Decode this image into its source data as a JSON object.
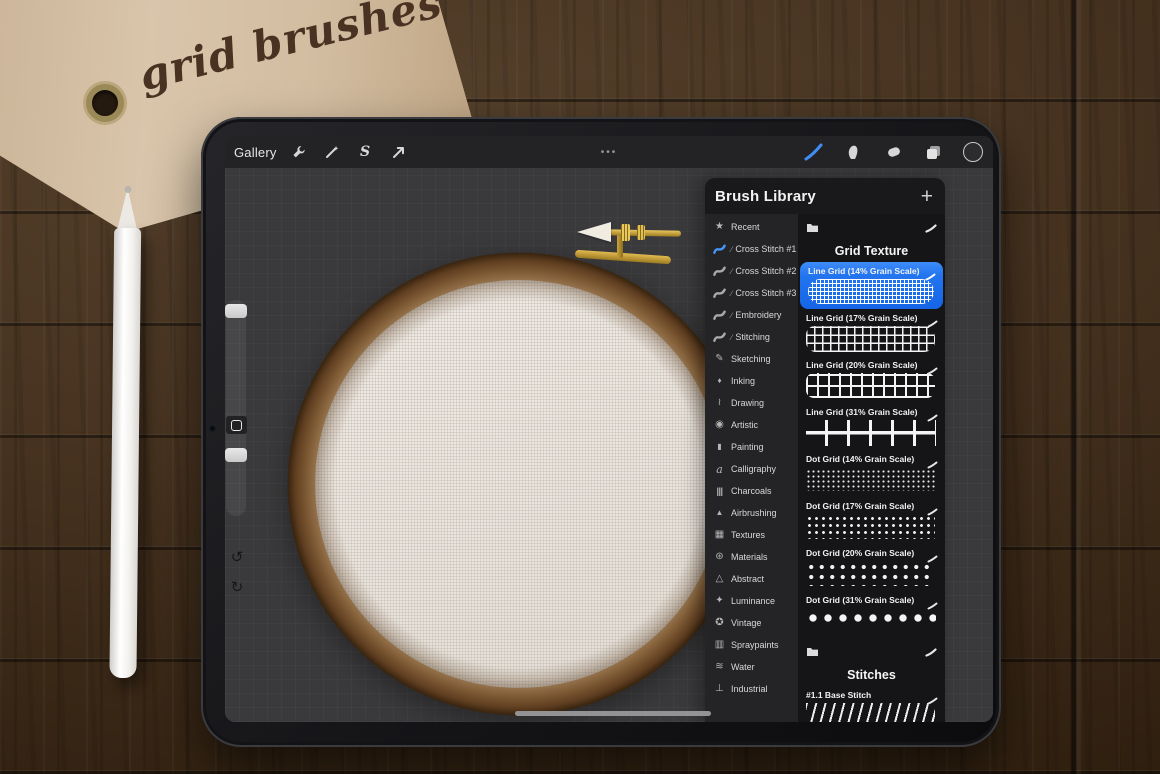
{
  "scene": {
    "tag_text": "grid brushes"
  },
  "topbar": {
    "gallery_label": "Gallery",
    "ellipsis": "•••",
    "selection_glyph": "S",
    "left_icons": [
      "wrench-icon",
      "adjustments-wand-icon",
      "selection-icon",
      "transform-arrow-icon"
    ],
    "right_icons": [
      "paint-brush-icon",
      "smudge-finger-icon",
      "eraser-icon",
      "layers-icon",
      "color-circle"
    ],
    "active_tool": "paint-brush",
    "accent_color": "#3f8ef7"
  },
  "side_tools": {
    "undo_glyph": "↺",
    "redo_glyph": "↻"
  },
  "library": {
    "title": "Brush Library",
    "add_label": "+",
    "set_prefix_glyph": "∕",
    "selected_brush": "Line Grid (14% Grain Scale)",
    "selected_color": "#2274ef",
    "categories": [
      {
        "label": "Recent",
        "icon": "star-icon",
        "glyph": "★"
      },
      {
        "label": "Cross Stitch #1",
        "icon": "brush-stroke-icon"
      },
      {
        "label": "Cross Stitch #2",
        "icon": "brush-stroke-icon"
      },
      {
        "label": "Cross Stitch #3",
        "icon": "brush-stroke-icon"
      },
      {
        "label": "Embroidery",
        "icon": "brush-stroke-icon"
      },
      {
        "label": "Stitching",
        "icon": "brush-stroke-icon"
      },
      {
        "label": "Sketching",
        "icon": "pencil-icon",
        "glyph": "✎"
      },
      {
        "label": "Inking",
        "icon": "ink-drop-icon",
        "glyph": "♦"
      },
      {
        "label": "Drawing",
        "icon": "squiggle-icon",
        "glyph": "≀"
      },
      {
        "label": "Artistic",
        "icon": "palette-icon",
        "glyph": "◉"
      },
      {
        "label": "Painting",
        "icon": "paint-brush-icon",
        "glyph": "▮"
      },
      {
        "label": "Calligraphy",
        "icon": "letter-a-icon",
        "glyph": "a"
      },
      {
        "label": "Charcoals",
        "icon": "bars-icon",
        "glyph": "|||"
      },
      {
        "label": "Airbrushing",
        "icon": "airbrush-icon",
        "glyph": "▲"
      },
      {
        "label": "Textures",
        "icon": "hatch-square-icon",
        "glyph": "▦"
      },
      {
        "label": "Materials",
        "icon": "sphere-icon",
        "glyph": "⊛"
      },
      {
        "label": "Abstract",
        "icon": "triangle-icon",
        "glyph": "△"
      },
      {
        "label": "Luminance",
        "icon": "sparkle-icon",
        "glyph": "✦"
      },
      {
        "label": "Vintage",
        "icon": "circled-star-icon",
        "glyph": "✪"
      },
      {
        "label": "Spraypaints",
        "icon": "spray-can-icon",
        "glyph": "▥"
      },
      {
        "label": "Water",
        "icon": "waves-icon",
        "glyph": "≋"
      },
      {
        "label": "Industrial",
        "icon": "anvil-icon",
        "glyph": "⊥"
      }
    ],
    "sections": [
      {
        "title": "Grid Texture",
        "brushes": [
          {
            "name": "Line Grid (14% Grain Scale)",
            "pattern": "fine-line-grid",
            "selected": true
          },
          {
            "name": "Line Grid (17% Grain Scale)",
            "pattern": "medium-line-grid"
          },
          {
            "name": "Line Grid (20% Grain Scale)",
            "pattern": "coarse-line-grid"
          },
          {
            "name": "Line Grid (31% Grain Scale)",
            "pattern": "extra-coarse-line-grid"
          },
          {
            "name": "Dot Grid (14% Grain Scale)",
            "pattern": "fine-dot-grid"
          },
          {
            "name": "Dot Grid (17% Grain Scale)",
            "pattern": "medium-dot-grid"
          },
          {
            "name": "Dot Grid (20% Grain Scale)",
            "pattern": "coarse-dot-grid"
          },
          {
            "name": "Dot Grid (31% Grain Scale)",
            "pattern": "extra-coarse-dot-grid"
          }
        ]
      },
      {
        "title": "Stitches",
        "brushes": [
          {
            "name": "#1.1 Base Stitch",
            "pattern": "stitch"
          }
        ]
      }
    ]
  }
}
